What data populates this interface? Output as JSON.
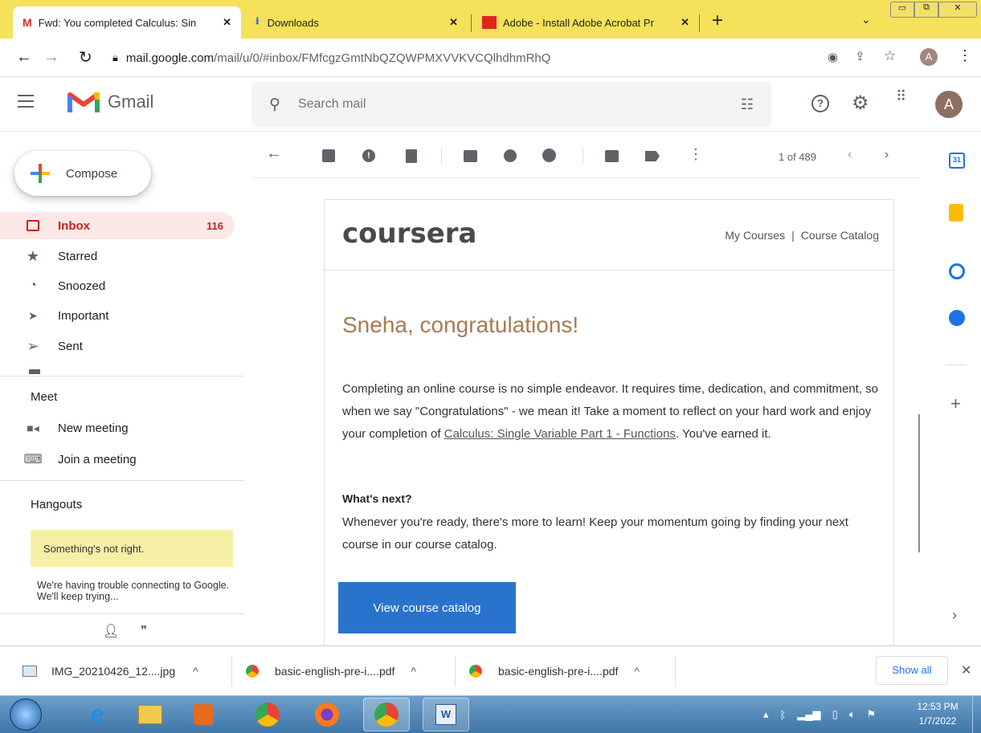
{
  "browser": {
    "tabs": [
      {
        "title": "Fwd: You completed Calculus: Sin",
        "close": "✕"
      },
      {
        "title": "Downloads",
        "close": "✕"
      },
      {
        "title": "Adobe - Install Adobe Acrobat Pr",
        "close": "✕"
      }
    ],
    "new_tab": "+",
    "url_host": "mail.google.com",
    "url_path": "/mail/u/0/#inbox/FMfcgzGmtNbQZQWPMXVVKVCQlhdhmRhQ",
    "profile_initial": "A",
    "accent": "#f6e15a"
  },
  "gmail": {
    "logo_text": "Gmail",
    "search_placeholder": "Search mail",
    "account_initial": "A"
  },
  "sidebar": {
    "compose_label": "Compose",
    "items": [
      {
        "label": "Inbox",
        "count": "116"
      },
      {
        "label": "Starred",
        "count": ""
      },
      {
        "label": "Snoozed",
        "count": ""
      },
      {
        "label": "Important",
        "count": ""
      },
      {
        "label": "Sent",
        "count": ""
      }
    ],
    "meet": {
      "header": "Meet",
      "new_meeting": "New meeting",
      "join_meeting": "Join a meeting"
    },
    "hangouts": {
      "header": "Hangouts",
      "warning": "Something's not right.",
      "message": "We're having trouble connecting to Google. We'll keep trying..."
    }
  },
  "toolbar": {
    "pagination": "1 of 489"
  },
  "email": {
    "brand": "coursera",
    "nav_my_courses": "My Courses",
    "nav_separator": "|",
    "nav_catalog": "Course Catalog",
    "heading": "Sneha, congratulations!",
    "para1_before_link": "Completing an online course is no simple endeavor. It requires time, dedication, and commitment, so when we say \"Congratulations\" - we mean it! Take a moment to reflect on your hard work and enjoy your completion of ",
    "course_link": "Calculus: Single Variable Part 1 - Functions",
    "para1_after_link": ". You've earned it.",
    "whats_next": "What's next?",
    "para2": "Whenever you're ready, there's more to learn! Keep your momentum going by finding your next course in our course catalog.",
    "cta": "View course catalog",
    "heading_color": "#a67c52",
    "cta_color": "#2a73cc"
  },
  "downloads": {
    "items": [
      "IMG_20210426_12....jpg",
      "basic-english-pre-i....pdf",
      "basic-english-pre-i....pdf"
    ],
    "show_all": "Show all"
  },
  "taskbar": {
    "time": "12:53 PM",
    "date": "1/7/2022"
  }
}
